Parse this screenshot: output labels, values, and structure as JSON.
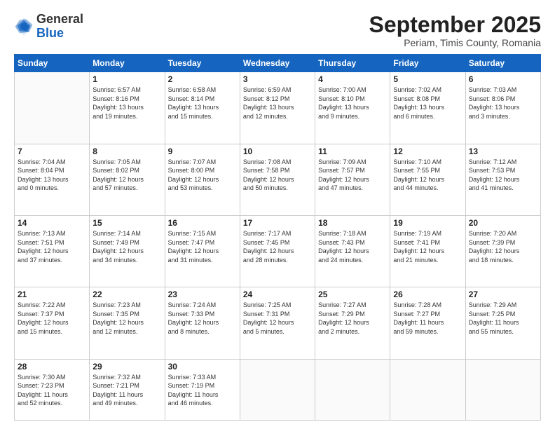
{
  "header": {
    "logo_general": "General",
    "logo_blue": "Blue",
    "month_title": "September 2025",
    "subtitle": "Periam, Timis County, Romania"
  },
  "days_of_week": [
    "Sunday",
    "Monday",
    "Tuesday",
    "Wednesday",
    "Thursday",
    "Friday",
    "Saturday"
  ],
  "weeks": [
    [
      {
        "day": "",
        "info": ""
      },
      {
        "day": "1",
        "info": "Sunrise: 6:57 AM\nSunset: 8:16 PM\nDaylight: 13 hours\nand 19 minutes."
      },
      {
        "day": "2",
        "info": "Sunrise: 6:58 AM\nSunset: 8:14 PM\nDaylight: 13 hours\nand 15 minutes."
      },
      {
        "day": "3",
        "info": "Sunrise: 6:59 AM\nSunset: 8:12 PM\nDaylight: 13 hours\nand 12 minutes."
      },
      {
        "day": "4",
        "info": "Sunrise: 7:00 AM\nSunset: 8:10 PM\nDaylight: 13 hours\nand 9 minutes."
      },
      {
        "day": "5",
        "info": "Sunrise: 7:02 AM\nSunset: 8:08 PM\nDaylight: 13 hours\nand 6 minutes."
      },
      {
        "day": "6",
        "info": "Sunrise: 7:03 AM\nSunset: 8:06 PM\nDaylight: 13 hours\nand 3 minutes."
      }
    ],
    [
      {
        "day": "7",
        "info": "Sunrise: 7:04 AM\nSunset: 8:04 PM\nDaylight: 13 hours\nand 0 minutes."
      },
      {
        "day": "8",
        "info": "Sunrise: 7:05 AM\nSunset: 8:02 PM\nDaylight: 12 hours\nand 57 minutes."
      },
      {
        "day": "9",
        "info": "Sunrise: 7:07 AM\nSunset: 8:00 PM\nDaylight: 12 hours\nand 53 minutes."
      },
      {
        "day": "10",
        "info": "Sunrise: 7:08 AM\nSunset: 7:58 PM\nDaylight: 12 hours\nand 50 minutes."
      },
      {
        "day": "11",
        "info": "Sunrise: 7:09 AM\nSunset: 7:57 PM\nDaylight: 12 hours\nand 47 minutes."
      },
      {
        "day": "12",
        "info": "Sunrise: 7:10 AM\nSunset: 7:55 PM\nDaylight: 12 hours\nand 44 minutes."
      },
      {
        "day": "13",
        "info": "Sunrise: 7:12 AM\nSunset: 7:53 PM\nDaylight: 12 hours\nand 41 minutes."
      }
    ],
    [
      {
        "day": "14",
        "info": "Sunrise: 7:13 AM\nSunset: 7:51 PM\nDaylight: 12 hours\nand 37 minutes."
      },
      {
        "day": "15",
        "info": "Sunrise: 7:14 AM\nSunset: 7:49 PM\nDaylight: 12 hours\nand 34 minutes."
      },
      {
        "day": "16",
        "info": "Sunrise: 7:15 AM\nSunset: 7:47 PM\nDaylight: 12 hours\nand 31 minutes."
      },
      {
        "day": "17",
        "info": "Sunrise: 7:17 AM\nSunset: 7:45 PM\nDaylight: 12 hours\nand 28 minutes."
      },
      {
        "day": "18",
        "info": "Sunrise: 7:18 AM\nSunset: 7:43 PM\nDaylight: 12 hours\nand 24 minutes."
      },
      {
        "day": "19",
        "info": "Sunrise: 7:19 AM\nSunset: 7:41 PM\nDaylight: 12 hours\nand 21 minutes."
      },
      {
        "day": "20",
        "info": "Sunrise: 7:20 AM\nSunset: 7:39 PM\nDaylight: 12 hours\nand 18 minutes."
      }
    ],
    [
      {
        "day": "21",
        "info": "Sunrise: 7:22 AM\nSunset: 7:37 PM\nDaylight: 12 hours\nand 15 minutes."
      },
      {
        "day": "22",
        "info": "Sunrise: 7:23 AM\nSunset: 7:35 PM\nDaylight: 12 hours\nand 12 minutes."
      },
      {
        "day": "23",
        "info": "Sunrise: 7:24 AM\nSunset: 7:33 PM\nDaylight: 12 hours\nand 8 minutes."
      },
      {
        "day": "24",
        "info": "Sunrise: 7:25 AM\nSunset: 7:31 PM\nDaylight: 12 hours\nand 5 minutes."
      },
      {
        "day": "25",
        "info": "Sunrise: 7:27 AM\nSunset: 7:29 PM\nDaylight: 12 hours\nand 2 minutes."
      },
      {
        "day": "26",
        "info": "Sunrise: 7:28 AM\nSunset: 7:27 PM\nDaylight: 11 hours\nand 59 minutes."
      },
      {
        "day": "27",
        "info": "Sunrise: 7:29 AM\nSunset: 7:25 PM\nDaylight: 11 hours\nand 55 minutes."
      }
    ],
    [
      {
        "day": "28",
        "info": "Sunrise: 7:30 AM\nSunset: 7:23 PM\nDaylight: 11 hours\nand 52 minutes."
      },
      {
        "day": "29",
        "info": "Sunrise: 7:32 AM\nSunset: 7:21 PM\nDaylight: 11 hours\nand 49 minutes."
      },
      {
        "day": "30",
        "info": "Sunrise: 7:33 AM\nSunset: 7:19 PM\nDaylight: 11 hours\nand 46 minutes."
      },
      {
        "day": "",
        "info": ""
      },
      {
        "day": "",
        "info": ""
      },
      {
        "day": "",
        "info": ""
      },
      {
        "day": "",
        "info": ""
      }
    ]
  ]
}
